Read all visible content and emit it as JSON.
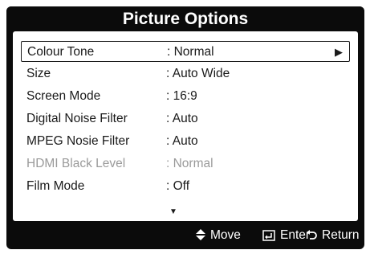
{
  "title": "Picture Options",
  "menu": [
    {
      "label": "Colour Tone",
      "value": ": Normal",
      "selected": true,
      "disabled": false,
      "arrow": "▶"
    },
    {
      "label": "Size",
      "value": ": Auto Wide",
      "selected": false,
      "disabled": false
    },
    {
      "label": "Screen Mode",
      "value": ": 16:9",
      "selected": false,
      "disabled": false
    },
    {
      "label": "Digital Noise Filter",
      "value": ": Auto",
      "selected": false,
      "disabled": false
    },
    {
      "label": "MPEG Nosie Filter",
      "value": ": Auto",
      "selected": false,
      "disabled": false
    },
    {
      "label": "HDMI Black Level",
      "value": ": Normal",
      "selected": false,
      "disabled": true
    },
    {
      "label": "Film Mode",
      "value": ": Off",
      "selected": false,
      "disabled": false
    }
  ],
  "scroll_indicator": "▼",
  "footer": {
    "move_label": "Move",
    "enter_label": "Enter",
    "return_label": "Return",
    "move_icon": "up-down-arrows-icon",
    "enter_icon": "enter-icon",
    "return_icon": "return-icon"
  },
  "colors": {
    "frame": "#0b0b0b",
    "panel": "#ffffff",
    "text": "#1a1a1a",
    "disabled_text": "#9a9a9a"
  }
}
